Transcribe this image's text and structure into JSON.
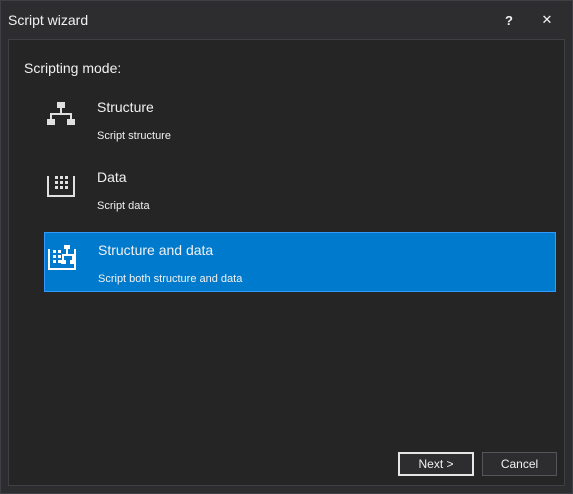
{
  "window": {
    "title": "Script wizard",
    "help_label": "?",
    "close_label": "✕"
  },
  "main": {
    "heading": "Scripting mode:",
    "options": [
      {
        "title": "Structure",
        "description": "Script structure",
        "icon": "structure-icon",
        "selected": false
      },
      {
        "title": "Data",
        "description": "Script data",
        "icon": "data-icon",
        "selected": false
      },
      {
        "title": "Structure and data",
        "description": "Script both structure and data",
        "icon": "structure-and-data-icon",
        "selected": true
      }
    ]
  },
  "footer": {
    "next_label": "Next >",
    "cancel_label": "Cancel"
  },
  "colors": {
    "background": "#2d2d30",
    "panel": "#252526",
    "selection": "#007acc",
    "text": "#f1f1f1"
  }
}
